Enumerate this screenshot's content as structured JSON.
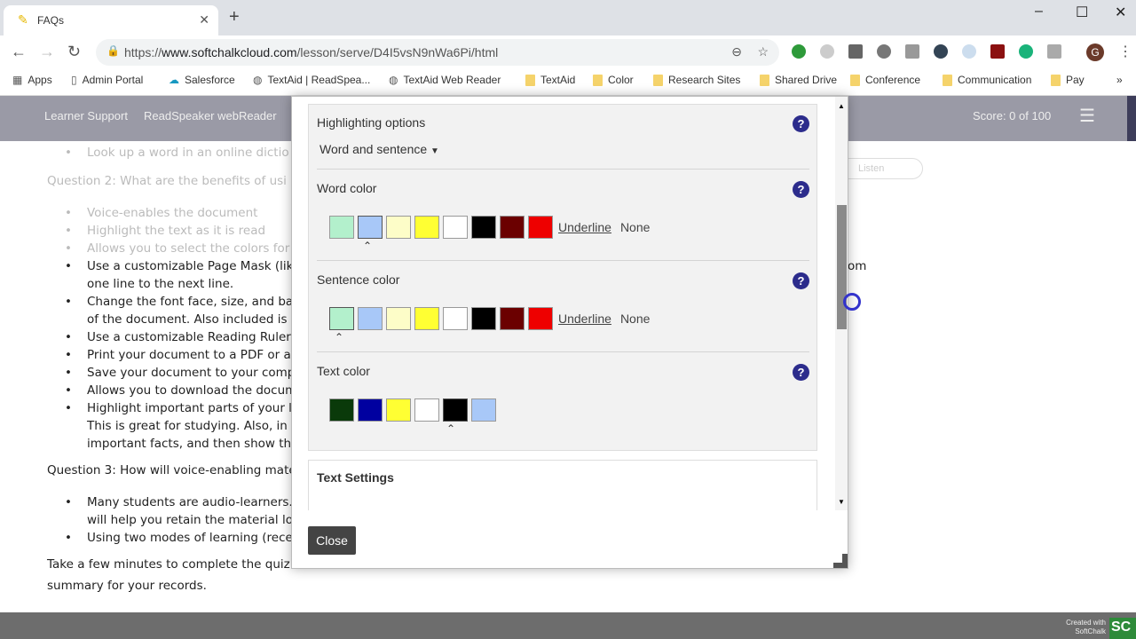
{
  "browser": {
    "tab_title": "FAQs",
    "url_scheme": "https://",
    "url_host": "www.softchalkcloud.com",
    "url_path": "/lesson/serve/D4I5vsN9nWa6Pi/html",
    "profile_initial": "G",
    "bookmarks": [
      "Apps",
      "Admin Portal",
      "Salesforce",
      "TextAid | ReadSpea...",
      "TextAid Web Reader",
      "TextAid",
      "Color",
      "Research Sites",
      "Shared Drive",
      "Conference",
      "Communication",
      "Pay"
    ]
  },
  "header": {
    "learner_support": "Learner Support",
    "readspeaker": "ReadSpeaker webReader",
    "score": "Score: 0 of 100"
  },
  "listen_label": "Listen",
  "content": {
    "lines": [
      {
        "t": "Look up a word in an online dictio",
        "kind": "li",
        "faded": true
      },
      {
        "t": "Question 2:   What are the benefits of usi",
        "kind": "p",
        "faded": true
      },
      {
        "t": "Voice-enables the document",
        "kind": "li",
        "faded": true
      },
      {
        "t": "Highlight the text as it is read",
        "kind": "li",
        "faded": true
      },
      {
        "t": "Allows you to select the colors for",
        "kind": "li",
        "faded": true
      },
      {
        "t": "Use a customizable Page Mask (lik",
        "kind": "li"
      },
      {
        "t": "one line to the next line.",
        "kind": "cont"
      },
      {
        "t": "Change the font face, size, and bac",
        "kind": "li"
      },
      {
        "t": "of the document.   Also included is",
        "kind": "cont"
      },
      {
        "t": "Use a customizable Reading Ruler",
        "kind": "li"
      },
      {
        "t": "Print your document to a PDF or a",
        "kind": "li"
      },
      {
        "t": "Save your document to your comp",
        "kind": "li"
      },
      {
        "t": "Allows you to download the docum",
        "kind": "li"
      },
      {
        "t": "Highlight important parts of your l",
        "kind": "li"
      },
      {
        "t": "This is great for studying.   Also, in",
        "kind": "cont"
      },
      {
        "t": "important facts, and then show th",
        "kind": "cont"
      },
      {
        "t": "Question 3: How will voice-enabling mate",
        "kind": "p"
      },
      {
        "t": "Many students are audio-learners.",
        "kind": "li"
      },
      {
        "t": "will help you retain the material lo",
        "kind": "cont"
      },
      {
        "t": "Using two modes of learning (rece",
        "kind": "li"
      },
      {
        "t": " Take a few minutes to complete the quiz",
        "kind": "p"
      },
      {
        "t": "summary for your records.",
        "kind": "p"
      }
    ],
    "right_fragment": "om"
  },
  "dialog": {
    "highlighting_label": "Highlighting options",
    "highlighting_value": "Word and sentence",
    "word_color_label": "Word color",
    "sentence_color_label": "Sentence color",
    "text_color_label": "Text color",
    "underline": "Underline",
    "none": "None",
    "highlight_swatches": [
      "#b3f0cc",
      "#a8c8f8",
      "#fdfdc8",
      "#ffff33",
      "#ffffff",
      "#000000",
      "#6b0000",
      "#ee0000"
    ],
    "word_selected": "#a8c8f8",
    "sentence_selected": "#b3f0cc",
    "text_swatches": [
      "#0a3a0a",
      "#0000a0",
      "#ffff33",
      "#ffffff",
      "#000000",
      "#a8c8f8"
    ],
    "text_selected": "#000000",
    "text_settings_label": "Text Settings",
    "close_label": "Close",
    "help_glyph": "?"
  },
  "footer": {
    "created_with": "Created with",
    "softchalk": "SoftChalk",
    "logo": "SC"
  }
}
